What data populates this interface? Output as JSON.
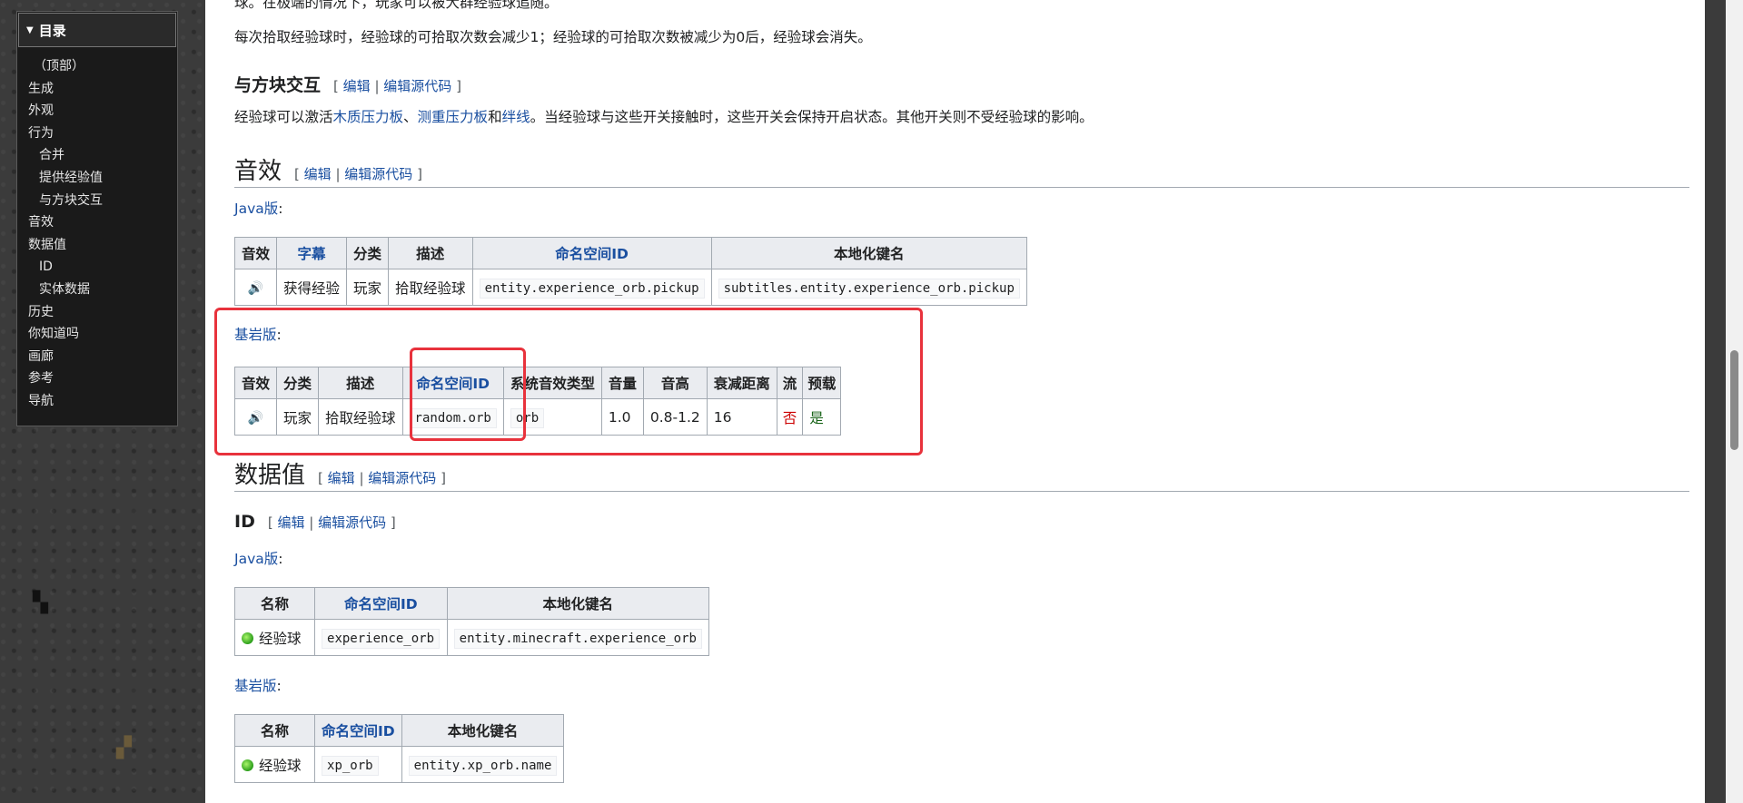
{
  "toc": {
    "title": "目录",
    "items": [
      {
        "label": "（顶部）",
        "level": "top"
      },
      {
        "label": "生成",
        "level": 1
      },
      {
        "label": "外观",
        "level": 1
      },
      {
        "label": "行为",
        "level": 1
      },
      {
        "label": "合并",
        "level": 2
      },
      {
        "label": "提供经验值",
        "level": 2
      },
      {
        "label": "与方块交互",
        "level": 2
      },
      {
        "label": "音效",
        "level": 1
      },
      {
        "label": "数据值",
        "level": 1
      },
      {
        "label": "ID",
        "level": 2
      },
      {
        "label": "实体数据",
        "level": 2
      },
      {
        "label": "历史",
        "level": 1
      },
      {
        "label": "你知道吗",
        "level": 1
      },
      {
        "label": "画廊",
        "level": 1
      },
      {
        "label": "参考",
        "level": 1
      },
      {
        "label": "导航",
        "level": 1
      }
    ]
  },
  "edit": {
    "open": "[",
    "edit": "编辑",
    "sep": "|",
    "source": "编辑源代码",
    "close": "]"
  },
  "para_top": "球。在极端的情况下，玩家可以被大群经验球追随。",
  "para_pickup": "每次拾取经验球时，经验球的可拾取次数会减少1；经验球的可拾取次数被减少为0后，经验球会消失。",
  "block_section": {
    "heading": "与方块交互",
    "text_pre": "经验球可以激活",
    "link1": "木质压力板",
    "sep1": "、",
    "link2": "测重压力板",
    "sep2": "和",
    "link3": "绊线",
    "text_post": "。当经验球与这些开关接触时，这些开关会保持开启状态。其他开关则不受经验球的影响。"
  },
  "sound_section": {
    "heading": "音效",
    "java_label": "Java版",
    "colon": ":",
    "java_table": {
      "headers": [
        "音效",
        "字幕",
        "分类",
        "描述",
        "命名空间ID",
        "本地化键名"
      ],
      "row": {
        "sound_icon": "speaker-icon",
        "subtitle": "获得经验",
        "category": "玩家",
        "desc": "拾取经验球",
        "namespace": "entity.experience_orb.pickup",
        "key": "subtitles.entity.experience_orb.pickup"
      }
    },
    "bedrock_label": "基岩版",
    "bedrock_table": {
      "headers": [
        "音效",
        "分类",
        "描述",
        "命名空间ID",
        "系统音效类型",
        "音量",
        "音高",
        "衰减距离",
        "流",
        "预载"
      ],
      "row": {
        "sound_icon": "speaker-icon",
        "category": "玩家",
        "desc": "拾取经验球",
        "namespace": "random.orb",
        "type": "orb",
        "volume": "1.0",
        "pitch": "0.8-1.2",
        "atten": "16",
        "stream": "否",
        "preload": "是"
      }
    }
  },
  "data_section": {
    "heading": "数据值",
    "id_heading": "ID",
    "java_label": "Java版",
    "bedrock_label": "基岩版",
    "colon": ":",
    "java_table": {
      "headers": [
        "名称",
        "命名空间ID",
        "本地化键名"
      ],
      "row": {
        "name": "经验球",
        "namespace": "experience_orb",
        "key": "entity.minecraft.experience_orb"
      }
    },
    "bedrock_table": {
      "headers": [
        "名称",
        "命名空间ID",
        "本地化键名"
      ],
      "row": {
        "name": "经验球",
        "namespace": "xp_orb",
        "key": "entity.xp_orb.name"
      }
    }
  },
  "colors": {
    "link": "#1a4fa0",
    "highlight": "#e8323c",
    "no_bg": "#ffd2d2",
    "yes_bg": "#d2f5d2"
  }
}
